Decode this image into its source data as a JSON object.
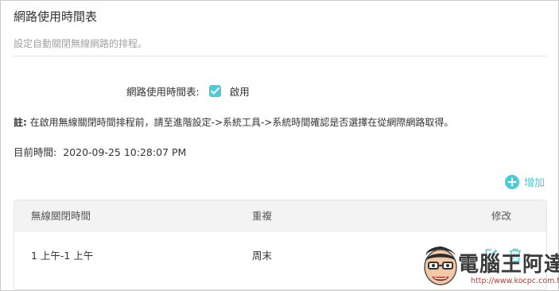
{
  "page": {
    "title": "網路使用時間表",
    "subtitle": "設定自動關閉無線網路的排程。"
  },
  "schedule": {
    "label": "網路使用時間表:",
    "enabled": true,
    "checkbox_label": "啟用"
  },
  "note": {
    "prefix": "註:",
    "text": " 在啟用無線關閉時間排程前，請至進階設定->系統工具->系統時間確認是否選擇在從網際網路取得。"
  },
  "current_time": {
    "label": "目前時間:",
    "value": "2020-09-25 10:28:07 PM"
  },
  "actions": {
    "add_label": "增加"
  },
  "table": {
    "columns": [
      "無線關閉時間",
      "重複",
      "修改"
    ],
    "rows": [
      {
        "time": "1 上午-1 上午",
        "repeat": "周末"
      }
    ]
  },
  "watermark": {
    "title": "電腦王阿達",
    "url": "http://www.kocpc.com.tw"
  },
  "colors": {
    "accent": "#4acbd6",
    "header_bg": "#f3f3f3",
    "muted_text": "#a3a3a3"
  },
  "icons": {
    "checkbox": "check-icon",
    "add": "plus-circle-icon",
    "edit": "edit-icon",
    "delete": "trash-icon"
  }
}
